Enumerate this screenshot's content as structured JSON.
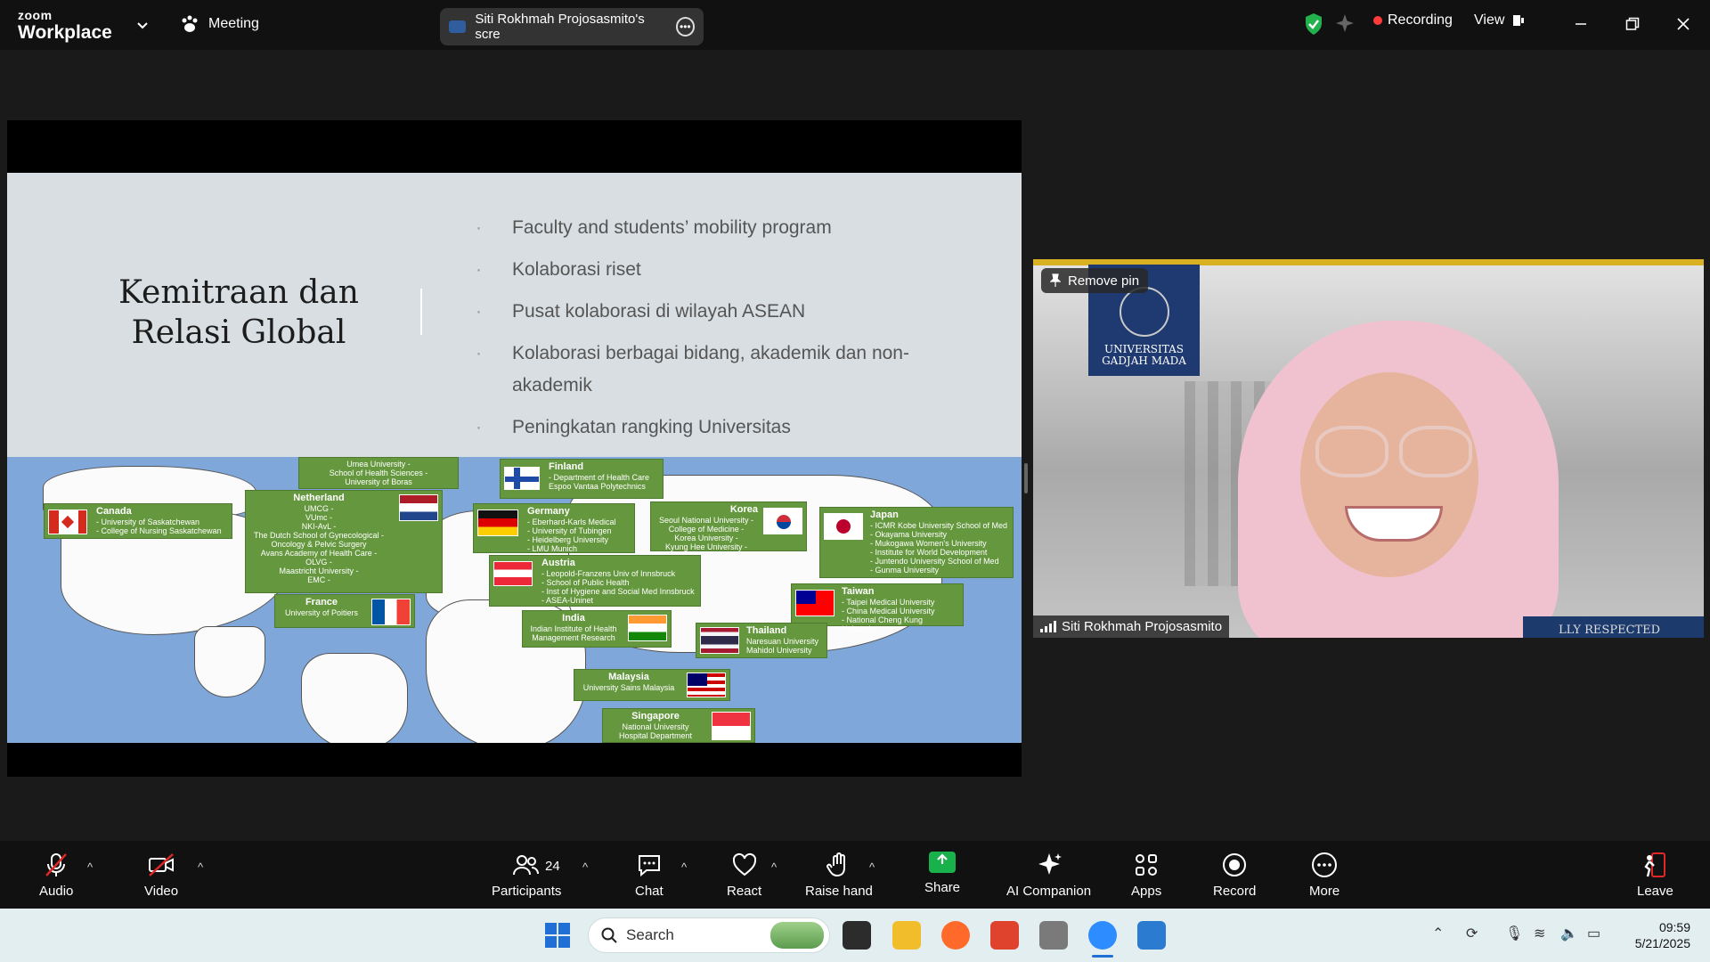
{
  "app": {
    "brand_top": "zoom",
    "brand_bottom": "Workplace",
    "meeting_label": "Meeting"
  },
  "share_pill": {
    "label": "Siti Rokhmah Projosasmito's scre"
  },
  "status": {
    "recording": "Recording",
    "view": "View"
  },
  "slide": {
    "title_line1": "Kemitraan dan",
    "title_line2": "Relasi Global",
    "bullets": [
      "Faculty and students’ mobility program",
      "Kolaborasi riset",
      "Pusat kolaborasi di wilayah ASEAN",
      "Kolaborasi berbagai bidang, akademik dan non-akademik",
      "Peningkatan rangking Universitas"
    ],
    "partners": {
      "sweden": [
        "Umea University -",
        "School of Health Sciences -",
        "University of Boras"
      ],
      "finland": {
        "country": "Finland",
        "lines": [
          "- Department of Health Care",
          "Espoo Vantaa Polytechnics"
        ]
      },
      "canada": {
        "country": "Canada",
        "lines": [
          "- University of Saskatchewan",
          "- College of Nursing Saskatchewan"
        ]
      },
      "netherland": {
        "country": "Netherland",
        "lines": [
          "UMCG -",
          "VUmc -",
          "NKI-AvL -",
          "The Dutch School of Gynecological -",
          "Oncology & Pelvic Surgery",
          "Avans Academy of Health Care -",
          "OLVG -",
          "Maastricht University -",
          "EMC -"
        ]
      },
      "germany": {
        "country": "Germany",
        "lines": [
          "- Eberhard-Karls Medical",
          "- University of Tubingen",
          "- Heidelberg University",
          "- LMU Munich"
        ]
      },
      "austria": {
        "country": "Austria",
        "lines": [
          "- Leopold-Franzens Univ of Innsbruck",
          "- School of Public Health",
          "- Inst of Hygiene and Social Med Innsbruck",
          "- ASEA-Uninet"
        ]
      },
      "korea": {
        "country": "Korea",
        "lines": [
          "Seoul National University -",
          "College of Medicine -",
          "Korea University -",
          "Kyung Hee University -"
        ]
      },
      "japan": {
        "country": "Japan",
        "lines": [
          "- ICMR Kobe University School of Med",
          "- Okayama University",
          "- Mukogawa Women's University",
          "- Institute for World Development",
          "- Juntendo University School of Med",
          "- Gunma University"
        ]
      },
      "taiwan": {
        "country": "Taiwan",
        "lines": [
          "- Taipei Medical University",
          "- China Medical University",
          "- National Cheng Kung University"
        ]
      },
      "france": {
        "country": "France",
        "lines": [
          "University of Poitiers"
        ]
      },
      "india": {
        "country": "India",
        "lines": [
          "Indian Institute of Health",
          "Management Research"
        ]
      },
      "thailand": {
        "country": "Thailand",
        "lines": [
          "Naresuan University",
          "Mahidol University"
        ]
      },
      "malaysia": {
        "country": "Malaysia",
        "lines": [
          "University Sains Malaysia"
        ]
      },
      "singapore": {
        "country": "Singapore",
        "lines": [
          "National University",
          "Hospital Department"
        ]
      }
    }
  },
  "video": {
    "pin_label": "Remove pin",
    "participant": "Siti Rokhmah Projosasmito",
    "logo_line1": "UNIVERSITAS",
    "logo_line2": "GADJAH MADA",
    "banner": "LLY RESPECTED"
  },
  "toolbar": {
    "audio": "Audio",
    "video": "Video",
    "participants": "Participants",
    "participant_count": "24",
    "chat": "Chat",
    "react": "React",
    "raise_hand": "Raise hand",
    "share": "Share",
    "ai_companion": "AI Companion",
    "apps": "Apps",
    "record": "Record",
    "more": "More",
    "leave": "Leave"
  },
  "taskbar": {
    "search_placeholder": "Search",
    "time": "09:59",
    "date": "5/21/2025"
  },
  "colors": {
    "accent_green": "#18b14b",
    "record_red": "#ff3b3b",
    "map_water": "#7fa7d9",
    "box_green": "#65983e"
  }
}
